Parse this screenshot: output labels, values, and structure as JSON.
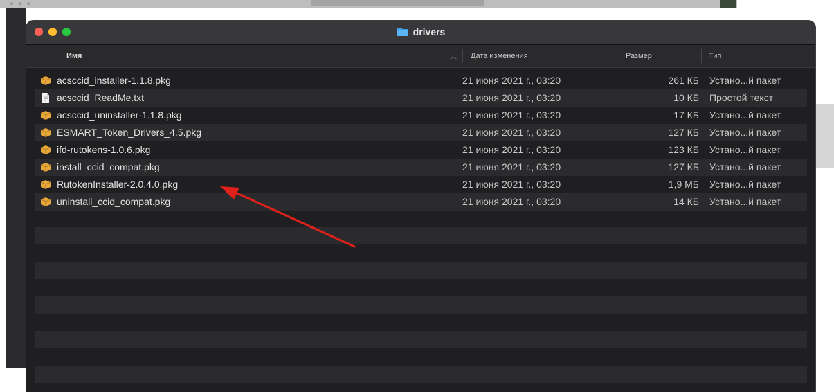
{
  "window": {
    "title": "drivers"
  },
  "columns": {
    "name": "Имя",
    "date": "Дата изменения",
    "size": "Размер",
    "kind": "Тип"
  },
  "files": [
    {
      "name": "acsccid_installer-1.1.8.pkg",
      "date": "21 июня 2021 г., 03:20",
      "size": "261 КБ",
      "kind": "Устано...й пакет",
      "icon": "package-icon"
    },
    {
      "name": "acsccid_ReadMe.txt",
      "date": "21 июня 2021 г., 03:20",
      "size": "10 КБ",
      "kind": "Простой текст",
      "icon": "text-file-icon"
    },
    {
      "name": "acsccid_uninstaller-1.1.8.pkg",
      "date": "21 июня 2021 г., 03:20",
      "size": "17 КБ",
      "kind": "Устано...й пакет",
      "icon": "package-icon"
    },
    {
      "name": "ESMART_Token_Drivers_4.5.pkg",
      "date": "21 июня 2021 г., 03:20",
      "size": "127 КБ",
      "kind": "Устано...й пакет",
      "icon": "package-icon"
    },
    {
      "name": "ifd-rutokens-1.0.6.pkg",
      "date": "21 июня 2021 г., 03:20",
      "size": "123 КБ",
      "kind": "Устано...й пакет",
      "icon": "package-icon"
    },
    {
      "name": "install_ccid_compat.pkg",
      "date": "21 июня 2021 г., 03:20",
      "size": "127 КБ",
      "kind": "Устано...й пакет",
      "icon": "package-icon"
    },
    {
      "name": "RutokenInstaller-2.0.4.0.pkg",
      "date": "21 июня 2021 г., 03:20",
      "size": "1,9 МБ",
      "kind": "Устано...й пакет",
      "icon": "package-icon"
    },
    {
      "name": "uninstall_ccid_compat.pkg",
      "date": "21 июня 2021 г., 03:20",
      "size": "14 КБ",
      "kind": "Устано...й пакет",
      "icon": "package-icon"
    }
  ],
  "colors": {
    "window_bg": "#1f1f21",
    "stripe": "#2b2b2d",
    "arrow": "#e0201b",
    "folder_accent": "#3aa0f0",
    "package_accent": "#e6a83a"
  }
}
